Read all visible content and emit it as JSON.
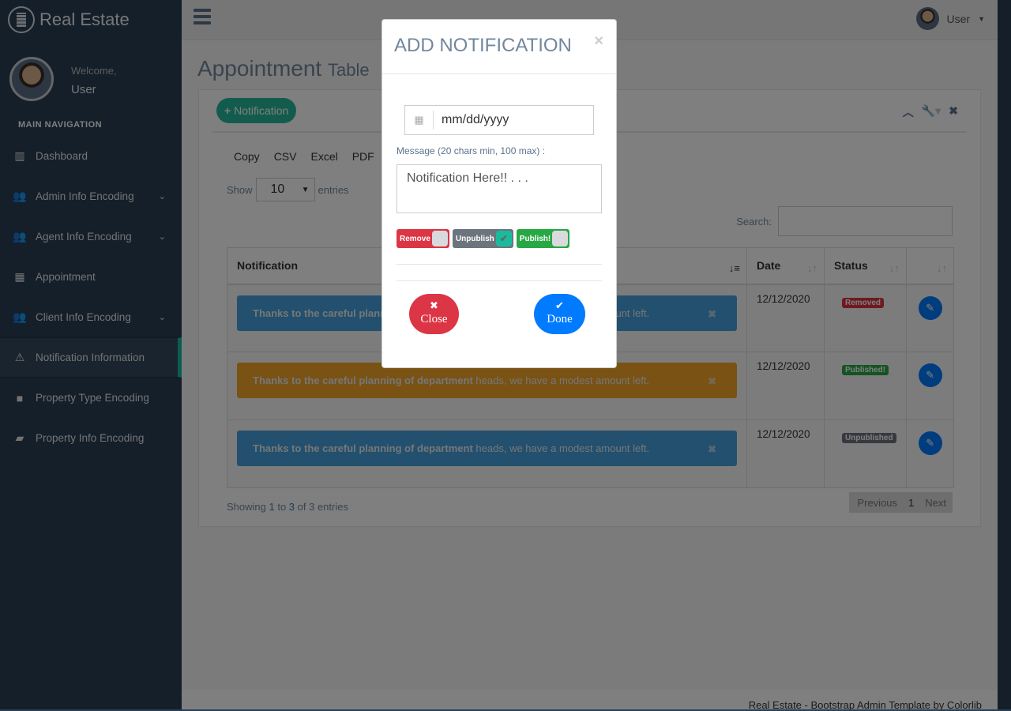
{
  "brand": "Real Estate",
  "profile": {
    "welcome": "Welcome,",
    "name": "User"
  },
  "nav_title": "MAIN NAVIGATION",
  "nav": [
    {
      "label": "Dashboard",
      "icon": "bar-chart-icon",
      "chevron": false
    },
    {
      "label": "Admin Info Encoding",
      "icon": "users-icon",
      "chevron": true
    },
    {
      "label": "Agent Info Encoding",
      "icon": "users-icon",
      "chevron": true
    },
    {
      "label": "Appointment",
      "icon": "calendar-icon",
      "chevron": false
    },
    {
      "label": "Client Info Encoding",
      "icon": "users-icon",
      "chevron": true
    },
    {
      "label": "Notification Information",
      "icon": "warning-icon",
      "chevron": false,
      "active": true
    },
    {
      "label": "Property Type Encoding",
      "icon": "folder-icon",
      "chevron": false
    },
    {
      "label": "Property Info Encoding",
      "icon": "folder-open-icon",
      "chevron": false
    }
  ],
  "topbar": {
    "user": "User"
  },
  "page": {
    "title": "Appointment",
    "subtitle": "Table"
  },
  "panel": {
    "add_button": "Notification"
  },
  "exports": [
    "Copy",
    "CSV",
    "Excel",
    "PDF"
  ],
  "length": {
    "show": "Show",
    "value": "10",
    "entries": "entries"
  },
  "search_label": "Search:",
  "table": {
    "headers": [
      "Notification",
      "Date",
      "Status",
      ""
    ],
    "rows": [
      {
        "bold": "Thanks to the careful planning of department",
        "rest": " heads, we have a modest amount left.",
        "color": "#3498DB",
        "date": "12/12/2020",
        "status": "Removed",
        "status_color": "#dc3545"
      },
      {
        "bold": "Thanks to the careful planning of department",
        "rest": " heads, we have a modest amount left.",
        "color": "#F39C12",
        "date": "12/12/2020",
        "status": "Published!",
        "status_color": "#28a745"
      },
      {
        "bold": "Thanks to the careful planning of department",
        "rest": " heads, we have a modest amount left.",
        "color": "#3498DB",
        "date": "12/12/2020",
        "status": "Unpublished",
        "status_color": "#6c757d"
      }
    ]
  },
  "info": {
    "pre": "Showing ",
    "from": "1",
    "mid1": " to ",
    "to": "3",
    "mid2": " of 3 entries"
  },
  "pagination": {
    "prev": "Previous",
    "page": "1",
    "next": "Next"
  },
  "footer": "Real Estate - Bootstrap Admin Template by Colorlib",
  "modal": {
    "title": "ADD NOTIFICATION",
    "close_x": "×",
    "date_placeholder": "mm/dd/yyyy",
    "message_label": "Message (20 chars min, 100 max) :",
    "message_value": "Notification Here!! . . .",
    "toggles": [
      {
        "label": "Remove",
        "color": "#dc3545",
        "checked": false
      },
      {
        "label": "Unpublish",
        "color": "#6c757d",
        "checked": true
      },
      {
        "label": "Publish!",
        "color": "#28a745",
        "checked": false
      }
    ],
    "close_button": "Close",
    "done_button": "Done"
  }
}
